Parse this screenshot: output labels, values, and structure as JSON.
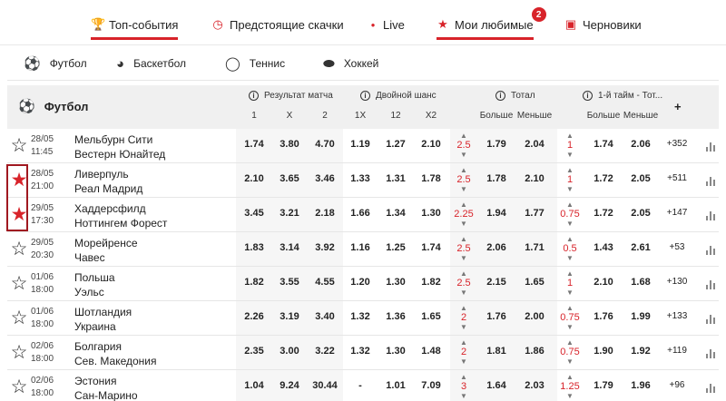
{
  "topnav": {
    "items": [
      {
        "label": "Топ-события",
        "icon": "trophy-icon"
      },
      {
        "label": "Предстоящие скачки",
        "icon": "clock-icon"
      },
      {
        "label": "Live",
        "icon": "dot-icon"
      },
      {
        "label": "Мои любимые",
        "icon": "star-icon",
        "badge": "2"
      },
      {
        "label": "Черновики",
        "icon": "save-icon"
      }
    ]
  },
  "sports": [
    {
      "label": "Футбол",
      "icon": "soccer-ball-icon"
    },
    {
      "label": "Баскетбол",
      "icon": "basketball-icon"
    },
    {
      "label": "Теннис",
      "icon": "tennis-ball-icon"
    },
    {
      "label": "Хоккей",
      "icon": "hockey-puck-icon"
    }
  ],
  "table": {
    "sport_title": "Футбол",
    "groups": [
      "Результат матча",
      "Двойной шанс",
      "Тотал",
      "1-й тайм - Тот..."
    ],
    "subheaders": [
      "1",
      "X",
      "2",
      "1X",
      "12",
      "X2",
      "Больше",
      "Меньше",
      "Больше",
      "Меньше"
    ],
    "plus": "+",
    "rows": [
      {
        "date": "28/05",
        "time": "11:45",
        "home": "Мельбурн Сити",
        "away": "Вестерн Юнайтед",
        "fav": false,
        "odds": [
          "1.74",
          "3.80",
          "4.70",
          "1.19",
          "1.27",
          "2.10"
        ],
        "total_line": "2.5",
        "total": [
          "1.79",
          "2.04"
        ],
        "ht_line": "1",
        "ht": [
          "1.74",
          "2.06"
        ],
        "more": "+352"
      },
      {
        "date": "28/05",
        "time": "21:00",
        "home": "Ливерпуль",
        "away": "Реал Мадрид",
        "fav": true,
        "odds": [
          "2.10",
          "3.65",
          "3.46",
          "1.33",
          "1.31",
          "1.78"
        ],
        "total_line": "2.5",
        "total": [
          "1.78",
          "2.10"
        ],
        "ht_line": "1",
        "ht": [
          "1.72",
          "2.05"
        ],
        "more": "+511"
      },
      {
        "date": "29/05",
        "time": "17:30",
        "home": "Хаддерсфилд",
        "away": "Ноттингем Форест",
        "fav": true,
        "odds": [
          "3.45",
          "3.21",
          "2.18",
          "1.66",
          "1.34",
          "1.30"
        ],
        "total_line": "2.25",
        "total": [
          "1.94",
          "1.77"
        ],
        "ht_line": "0.75",
        "ht": [
          "1.72",
          "2.05"
        ],
        "more": "+147"
      },
      {
        "date": "29/05",
        "time": "20:30",
        "home": "Морейренсе",
        "away": "Чавес",
        "fav": false,
        "odds": [
          "1.83",
          "3.14",
          "3.92",
          "1.16",
          "1.25",
          "1.74"
        ],
        "total_line": "2.5",
        "total": [
          "2.06",
          "1.71"
        ],
        "ht_line": "0.5",
        "ht": [
          "1.43",
          "2.61"
        ],
        "more": "+53"
      },
      {
        "date": "01/06",
        "time": "18:00",
        "home": "Польша",
        "away": "Уэльс",
        "fav": false,
        "odds": [
          "1.82",
          "3.55",
          "4.55",
          "1.20",
          "1.30",
          "1.82"
        ],
        "total_line": "2.5",
        "total": [
          "2.15",
          "1.65"
        ],
        "ht_line": "1",
        "ht": [
          "2.10",
          "1.68"
        ],
        "more": "+130"
      },
      {
        "date": "01/06",
        "time": "18:00",
        "home": "Шотландия",
        "away": "Украина",
        "fav": false,
        "odds": [
          "2.26",
          "3.19",
          "3.40",
          "1.32",
          "1.36",
          "1.65"
        ],
        "total_line": "2",
        "total": [
          "1.76",
          "2.00"
        ],
        "ht_line": "0.75",
        "ht": [
          "1.76",
          "1.99"
        ],
        "more": "+133"
      },
      {
        "date": "02/06",
        "time": "18:00",
        "home": "Болгария",
        "away": "Сев. Македония",
        "fav": false,
        "odds": [
          "2.35",
          "3.00",
          "3.22",
          "1.32",
          "1.30",
          "1.48"
        ],
        "total_line": "2",
        "total": [
          "1.81",
          "1.86"
        ],
        "ht_line": "0.75",
        "ht": [
          "1.90",
          "1.92"
        ],
        "more": "+119"
      },
      {
        "date": "02/06",
        "time": "18:00",
        "home": "Эстония",
        "away": "Сан-Марино",
        "fav": false,
        "odds": [
          "1.04",
          "9.24",
          "30.44",
          "-",
          "1.01",
          "7.09"
        ],
        "total_line": "3",
        "total": [
          "1.64",
          "2.03"
        ],
        "ht_line": "1.25",
        "ht": [
          "1.79",
          "1.96"
        ],
        "more": "+96"
      }
    ]
  },
  "colors": {
    "accent": "#d8232a",
    "header_bg": "#f0f0f0"
  }
}
